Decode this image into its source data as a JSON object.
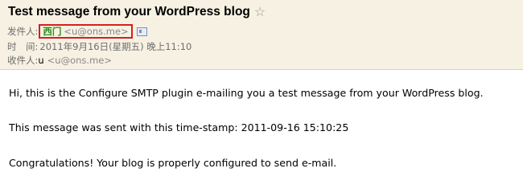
{
  "header": {
    "subject": "Test message from your WordPress blog",
    "star_glyph": "☆",
    "from_label": "发件人:",
    "from_name": "西门",
    "from_email": "<u@ons.me>",
    "time_label": "时　间:",
    "time_value": "2011年9月16日(星期五) 晚上11:10",
    "to_label": "收件人:",
    "to_name": "u",
    "to_email": "<u@ons.me>"
  },
  "body": {
    "line1": "Hi, this is the Configure SMTP plugin e-mailing you a test message from your WordPress blog.",
    "line2": "This message was sent with this time-stamp: 2011-09-16 15:10:25",
    "line3": "Congratulations!  Your blog is properly configured to send e-mail."
  },
  "colors": {
    "header_bg": "#f7f1e3",
    "highlight_border": "#d42020",
    "sender_name": "#2e8a1a"
  }
}
